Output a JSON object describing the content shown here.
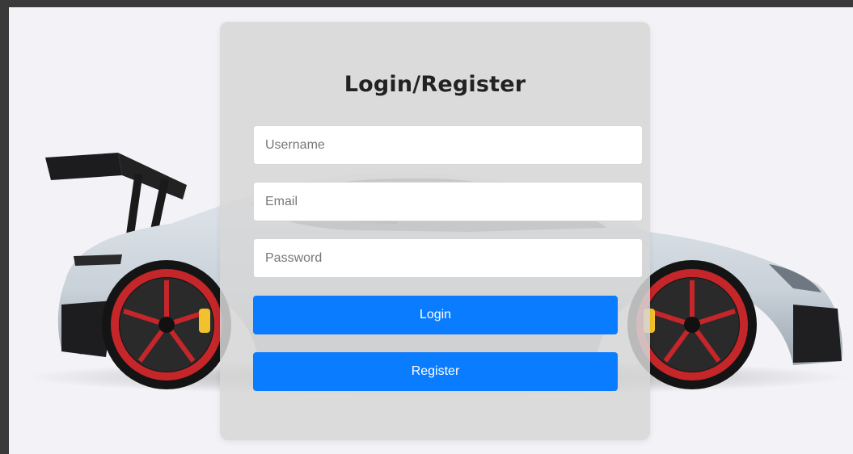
{
  "page": {
    "title": "Login/Register"
  },
  "form": {
    "username_placeholder": "Username",
    "email_placeholder": "Email",
    "password_placeholder": "Password",
    "login_label": "Login",
    "register_label": "Register"
  },
  "colors": {
    "primary_button": "#0a7cff",
    "card_background": "#d6d6d6",
    "page_background": "#f3f3f7",
    "frame": "#3a3a3a"
  },
  "images": {
    "background": "sports-car-image"
  }
}
